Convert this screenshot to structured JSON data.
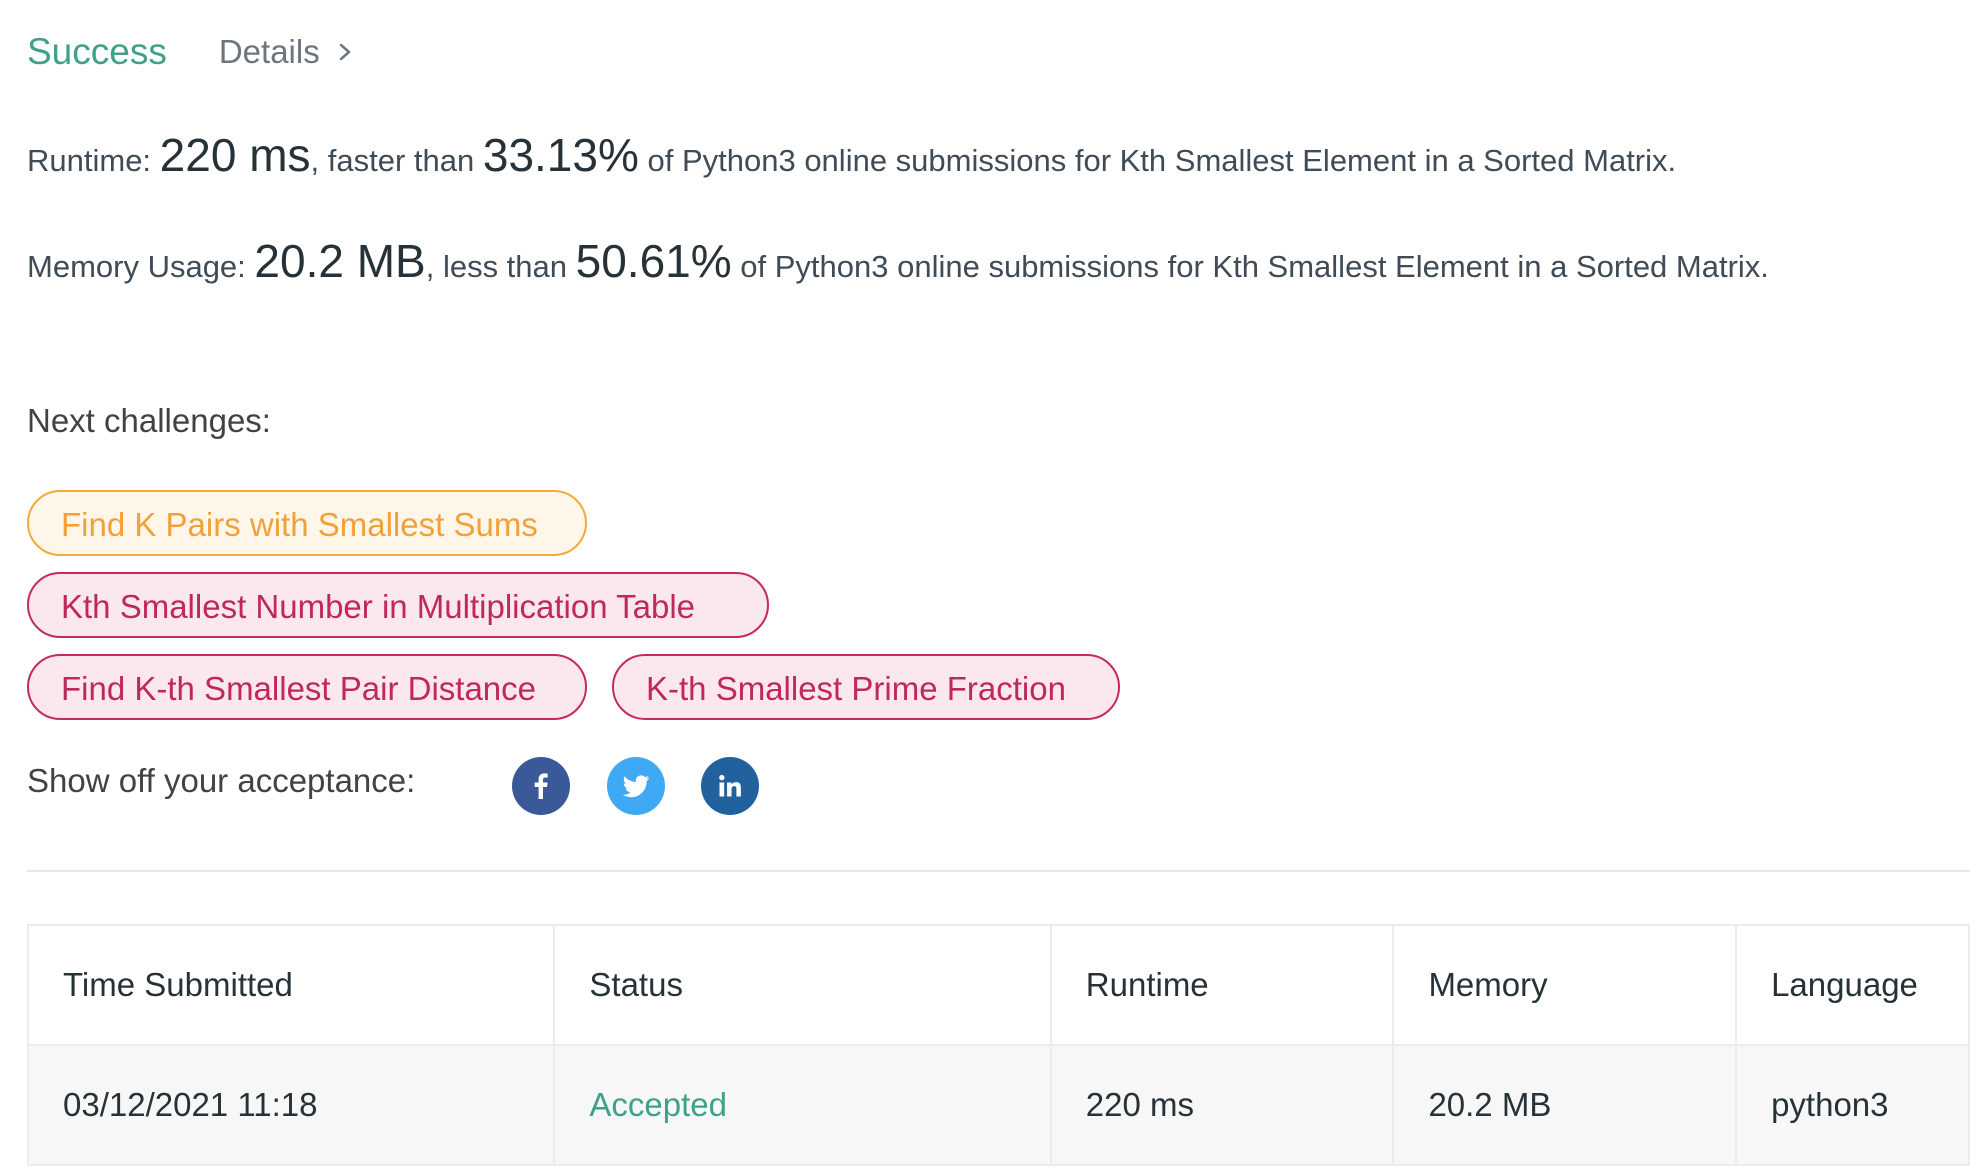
{
  "header": {
    "status_label": "Success",
    "details_label": "Details"
  },
  "runtime": {
    "prefix": "Runtime: ",
    "value": "220 ms",
    "faster_text": ", faster than ",
    "percent": "33.13%",
    "suffix": " of Python3 online submissions for Kth Smallest Element in a Sorted Matrix."
  },
  "memory": {
    "prefix": "Memory Usage: ",
    "value": "20.2 MB",
    "less_text": ", less than ",
    "percent": "50.61%",
    "suffix": " of Python3 online submissions for Kth Smallest Element in a Sorted Matrix."
  },
  "next_challenges": {
    "label": "Next challenges:",
    "items": [
      {
        "title": "Find K Pairs with Smallest Sums",
        "difficulty": "medium"
      },
      {
        "title": "Kth Smallest Number in Multiplication Table",
        "difficulty": "hard"
      },
      {
        "title": "Find K-th Smallest Pair Distance",
        "difficulty": "hard"
      },
      {
        "title": "K-th Smallest Prime Fraction",
        "difficulty": "hard"
      }
    ]
  },
  "share": {
    "label": "Show off your acceptance:",
    "icons": [
      "facebook-icon",
      "twitter-icon",
      "linkedin-icon"
    ]
  },
  "submissions": {
    "headers": [
      "Time Submitted",
      "Status",
      "Runtime",
      "Memory",
      "Language"
    ],
    "rows": [
      [
        "03/12/2021 11:18",
        "Accepted",
        "220 ms",
        "20.2 MB",
        "python3"
      ]
    ]
  },
  "colors": {
    "success": "#40a189",
    "medium_tag": "#f0a13a",
    "hard_tag": "#c0285a",
    "facebook": "#3b5998",
    "twitter": "#3fa9f5",
    "linkedin": "#21629e"
  }
}
